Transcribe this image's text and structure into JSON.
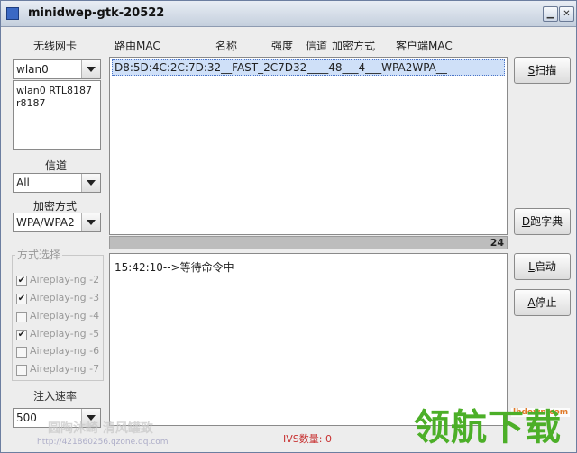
{
  "window": {
    "title": "minidwep-gtk-20522"
  },
  "left": {
    "nic_label": "无线网卡",
    "nic_value": "wlan0",
    "nic_info": [
      "wlan0 RTL8187",
      "r8187"
    ],
    "channel_label": "信道",
    "channel_value": "All",
    "encryption_label": "加密方式",
    "encryption_value": "WPA/WPA2",
    "mode_group_title": "方式选择",
    "modes": [
      {
        "label": "Aireplay-ng -2",
        "checked": true
      },
      {
        "label": "Aireplay-ng -3",
        "checked": true
      },
      {
        "label": "Aireplay-ng -4",
        "checked": false
      },
      {
        "label": "Aireplay-ng -5",
        "checked": true
      },
      {
        "label": "Aireplay-ng -6",
        "checked": false
      },
      {
        "label": "Aireplay-ng -7",
        "checked": false
      }
    ],
    "rate_label": "注入速率",
    "rate_value": "500"
  },
  "table": {
    "headers": [
      "路由MAC",
      "名称",
      "强度",
      "信道",
      "加密方式",
      "客户端MAC"
    ],
    "rows": [
      {
        "text": "D8:5D:4C:2C:7D:32__FAST_2C7D32____48___4___WPA2WPA__"
      }
    ]
  },
  "progress": {
    "value": "24"
  },
  "log": {
    "lines": [
      "15:42:10-->等待命令中"
    ]
  },
  "buttons": {
    "scan_key": "S",
    "scan": "扫描",
    "dict_key": "D",
    "dict": "跑字典",
    "start_key": "L",
    "start": "启动",
    "stop_key": "A",
    "stop": "停止"
  },
  "status": {
    "ivs": "IVS数量: 0"
  },
  "watermark": {
    "left_text": "圆陶沐崎 清风罐致",
    "url": "http://421860256.qzone.qq.com",
    "brand": "领航下载",
    "brand_url": "lhdown.com"
  }
}
